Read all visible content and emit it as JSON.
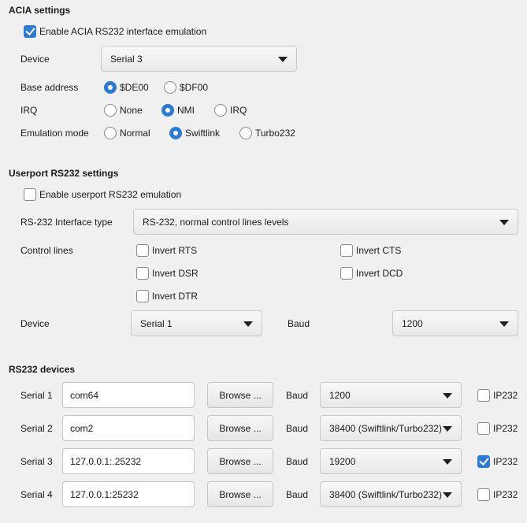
{
  "acia": {
    "title": "ACIA settings",
    "enable_label": "Enable ACIA RS232 interface emulation",
    "enable_checked": true,
    "device_label": "Device",
    "device_value": "Serial 3",
    "base_address_label": "Base address",
    "base_address_options": [
      "$DE00",
      "$DF00"
    ],
    "base_address_selected": "$DE00",
    "irq_label": "IRQ",
    "irq_options": [
      "None",
      "NMI",
      "IRQ"
    ],
    "irq_selected": "NMI",
    "emulation_label": "Emulation mode",
    "emulation_options": [
      "Normal",
      "Swiftlink",
      "Turbo232"
    ],
    "emulation_selected": "Swiftlink"
  },
  "userport": {
    "title": "Userport RS232 settings",
    "enable_label": "Enable userport RS232 emulation",
    "enable_checked": false,
    "interface_label": "RS-232 Interface type",
    "interface_value": "RS-232, normal control lines levels",
    "control_label": "Control lines",
    "invert_rts": "Invert RTS",
    "invert_cts": "Invert CTS",
    "invert_dsr": "Invert DSR",
    "invert_dcd": "Invert DCD",
    "invert_dtr": "Invert DTR",
    "device_label": "Device",
    "device_value": "Serial 1",
    "baud_label": "Baud",
    "baud_value": "1200"
  },
  "devices": {
    "title": "RS232 devices",
    "browse_label": "Browse ...",
    "baud_label": "Baud",
    "ip_label": "IP232",
    "rows": [
      {
        "label": "Serial 1",
        "path": "com64",
        "baud": "1200",
        "ip232": false
      },
      {
        "label": "Serial 2",
        "path": "com2",
        "baud": "38400 (Swiftlink/Turbo232)",
        "ip232": false
      },
      {
        "label": "Serial 3",
        "path": "127.0.0.1:.25232",
        "baud": "19200",
        "ip232": true
      },
      {
        "label": "Serial 4",
        "path": "127.0.0.1:25232",
        "baud": "38400 (Swiftlink/Turbo232)",
        "ip232": false
      }
    ]
  },
  "colors": {
    "accent": "#2b7bd6",
    "background": "#f0f0f0"
  }
}
